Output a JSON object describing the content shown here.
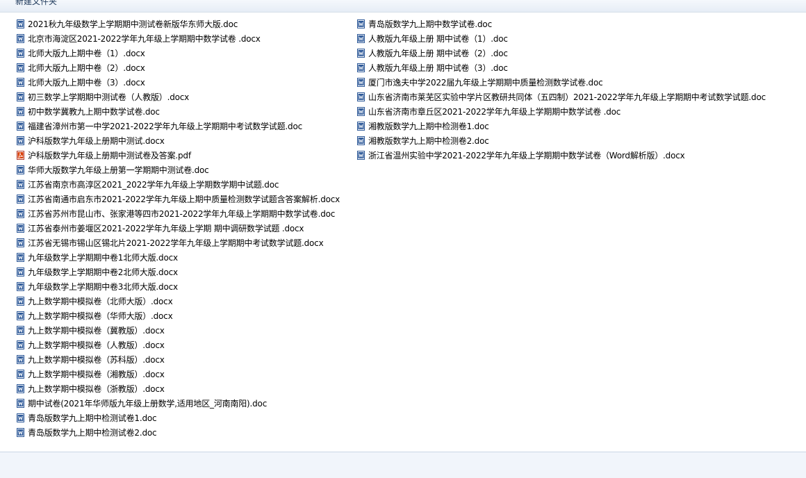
{
  "toolbar": {
    "new_folder_label": "新建文件夹"
  },
  "colors": {
    "word_icon": "#2b5797",
    "pdf_icon": "#d83b01",
    "status_bar": "#f1f5fb",
    "toolbar": "#e6edf6"
  },
  "files": {
    "left": [
      {
        "name": "2021秋九年级数学上学期期中测试卷新版华东师大版.doc",
        "icon": "word-icon"
      },
      {
        "name": "北京市海淀区2021-2022学年九年级上学期期中数学试卷 .docx",
        "icon": "word-icon"
      },
      {
        "name": "北师大版九上期中卷（1）.docx",
        "icon": "word-icon"
      },
      {
        "name": "北师大版九上期中卷（2）.docx",
        "icon": "word-icon"
      },
      {
        "name": "北师大版九上期中卷（3）.docx",
        "icon": "word-icon"
      },
      {
        "name": "初三数学上学期期中测试卷（人教版）.docx",
        "icon": "word-icon"
      },
      {
        "name": "初中数学冀教九上期中数学试卷.doc",
        "icon": "word-icon"
      },
      {
        "name": "福建省漳州市第一中学2021-2022学年九年级上学期期中考试数学试题.doc",
        "icon": "word-icon"
      },
      {
        "name": "沪科版数学九年级上册期中测试.docx",
        "icon": "word-icon"
      },
      {
        "name": "沪科版数学九年级上册期中测试卷及答案.pdf",
        "icon": "pdf-icon"
      },
      {
        "name": "华师大版数学九年级上册第一学期期中测试卷.doc",
        "icon": "word-icon"
      },
      {
        "name": "江苏省南京市高淳区2021_2022学年九年级上学期数学期中试题.doc",
        "icon": "word-icon"
      },
      {
        "name": "江苏省南通市启东市2021-2022学年九年级上期中质量检测数学试题含答案解析.docx",
        "icon": "word-icon"
      },
      {
        "name": "江苏省苏州市昆山市、张家港等四市2021-2022学年九年级上学期期中数学试卷.doc",
        "icon": "word-icon"
      },
      {
        "name": "江苏省泰州市姜堰区2021-2022学年九年级上学期 期中调研数学试题 .docx",
        "icon": "word-icon"
      },
      {
        "name": "江苏省无锡市锡山区锡北片2021-2022学年九年级上学期期中考试数学试题.docx",
        "icon": "word-icon"
      },
      {
        "name": "九年级数学上学期期中卷1北师大版.docx",
        "icon": "word-icon"
      },
      {
        "name": "九年级数学上学期期中卷2北师大版.docx",
        "icon": "word-icon"
      },
      {
        "name": "九年级数学上学期期中卷3北师大版.docx",
        "icon": "word-icon"
      },
      {
        "name": "九上数学期中模拟卷（北师大版）.docx",
        "icon": "word-icon"
      },
      {
        "name": "九上数学期中模拟卷（华师大版）.docx",
        "icon": "word-icon"
      },
      {
        "name": "九上数学期中模拟卷（冀教版）.docx",
        "icon": "word-icon"
      },
      {
        "name": "九上数学期中模拟卷（人教版）.docx",
        "icon": "word-icon"
      },
      {
        "name": "九上数学期中模拟卷（苏科版）.docx",
        "icon": "word-icon"
      },
      {
        "name": "九上数学期中模拟卷（湘教版）.docx",
        "icon": "word-icon"
      },
      {
        "name": "九上数学期中模拟卷（浙教版）.docx",
        "icon": "word-icon"
      },
      {
        "name": "期中试卷(2021年华师版九年级上册数学,适用地区_河南南阳).doc",
        "icon": "word-icon"
      },
      {
        "name": "青岛版数学九上期中检测试卷1.doc",
        "icon": "word-icon"
      },
      {
        "name": "青岛版数学九上期中检测试卷2.doc",
        "icon": "word-icon"
      }
    ],
    "right": [
      {
        "name": "青岛版数学九上期中数学试卷.doc",
        "icon": "word-icon"
      },
      {
        "name": "人教版九年级上册 期中试卷（1）.doc",
        "icon": "word-icon"
      },
      {
        "name": "人教版九年级上册 期中试卷（2）.doc",
        "icon": "word-icon"
      },
      {
        "name": "人教版九年级上册 期中试卷（3）.doc",
        "icon": "word-icon"
      },
      {
        "name": "厦门市逸夫中学2022届九年级上学期期中质量检测数学试卷.doc",
        "icon": "word-icon"
      },
      {
        "name": "山东省济南市莱芜区实验中学片区教研共同体（五四制）2021-2022学年九年级上学期期中考试数学试题.doc",
        "icon": "word-icon"
      },
      {
        "name": "山东省济南市章丘区2021-2022学年九年级上学期期中数学试卷 .doc",
        "icon": "word-icon"
      },
      {
        "name": "湘教版数学九上期中检测卷1.doc",
        "icon": "word-icon"
      },
      {
        "name": "湘教版数学九上期中检测卷2.doc",
        "icon": "word-icon"
      },
      {
        "name": "浙江省温州实验中学2021-2022学年九年级上学期期中数学试卷（Word解析版）.docx",
        "icon": "word-icon"
      }
    ]
  }
}
